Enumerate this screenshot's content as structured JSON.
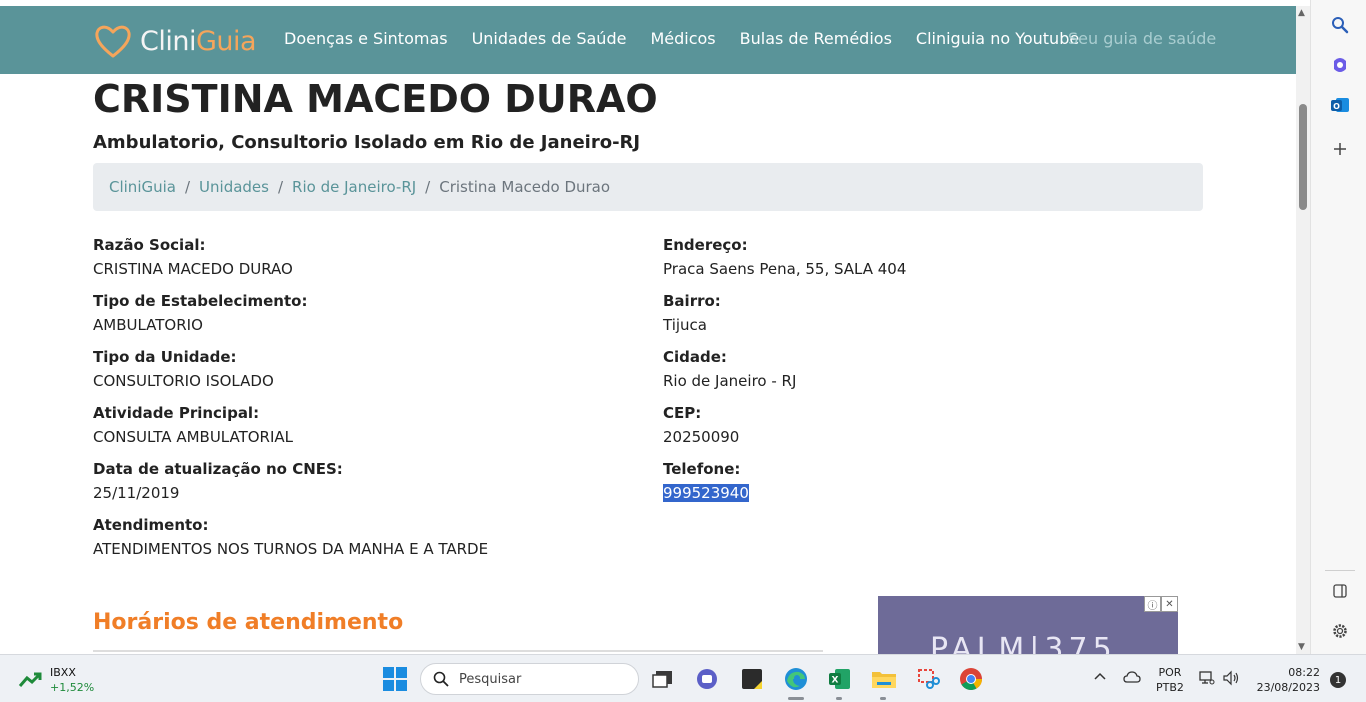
{
  "site": {
    "logo_part1": "Clini",
    "logo_part2": "Guia",
    "nav": [
      "Doenças e Sintomas",
      "Unidades de Saúde",
      "Médicos",
      "Bulas de Remédios",
      "Cliniguia no Youtube"
    ],
    "tagline": "Seu guia de saúde"
  },
  "page": {
    "title": "CRISTINA MACEDO DURAO",
    "subtitle": "Ambulatorio, Consultorio Isolado em Rio de Janeiro-RJ",
    "breadcrumb": [
      "CliniGuia",
      "Unidades",
      "Rio de Janeiro-RJ",
      "Cristina Macedo Durao"
    ],
    "breadcrumb_sep": "/",
    "left_fields": [
      {
        "label": "Razão Social:",
        "value": "CRISTINA MACEDO DURAO"
      },
      {
        "label": "Tipo de Estabelecimento:",
        "value": "AMBULATORIO"
      },
      {
        "label": "Tipo da Unidade:",
        "value": "CONSULTORIO ISOLADO"
      },
      {
        "label": "Atividade Principal:",
        "value": "CONSULTA AMBULATORIAL"
      },
      {
        "label": "Data de atualização no CNES:",
        "value": "25/11/2019"
      },
      {
        "label": "Atendimento:",
        "value": "ATENDIMENTOS NOS TURNOS DA MANHA E A TARDE"
      }
    ],
    "right_fields": [
      {
        "label": "Endereço:",
        "value": "Praca Saens Pena, 55, SALA 404"
      },
      {
        "label": "Bairro:",
        "value": "Tijuca"
      },
      {
        "label": "Cidade:",
        "value": "Rio de Janeiro - RJ"
      },
      {
        "label": "CEP:",
        "value": "20250090"
      },
      {
        "label": "Telefone:",
        "value": "999523940"
      }
    ],
    "section_title": "Horários de atendimento",
    "ad_text": "PALM|375"
  },
  "colors": {
    "nav_bg": "#5a9499",
    "accent_orange": "#f07e27",
    "selection": "#3366cc"
  },
  "edge_sidebar": [
    "search-icon",
    "copilot-icon",
    "outlook-icon",
    "plus-icon",
    "sidebar-toggle-icon",
    "gear-icon"
  ],
  "taskbar": {
    "stock_name": "IBXX",
    "stock_change": "+1,52%",
    "search_placeholder": "Pesquisar",
    "lang_1": "POR",
    "lang_2": "PTB2",
    "time": "08:22",
    "date": "23/08/2023",
    "notification_count": "1"
  }
}
